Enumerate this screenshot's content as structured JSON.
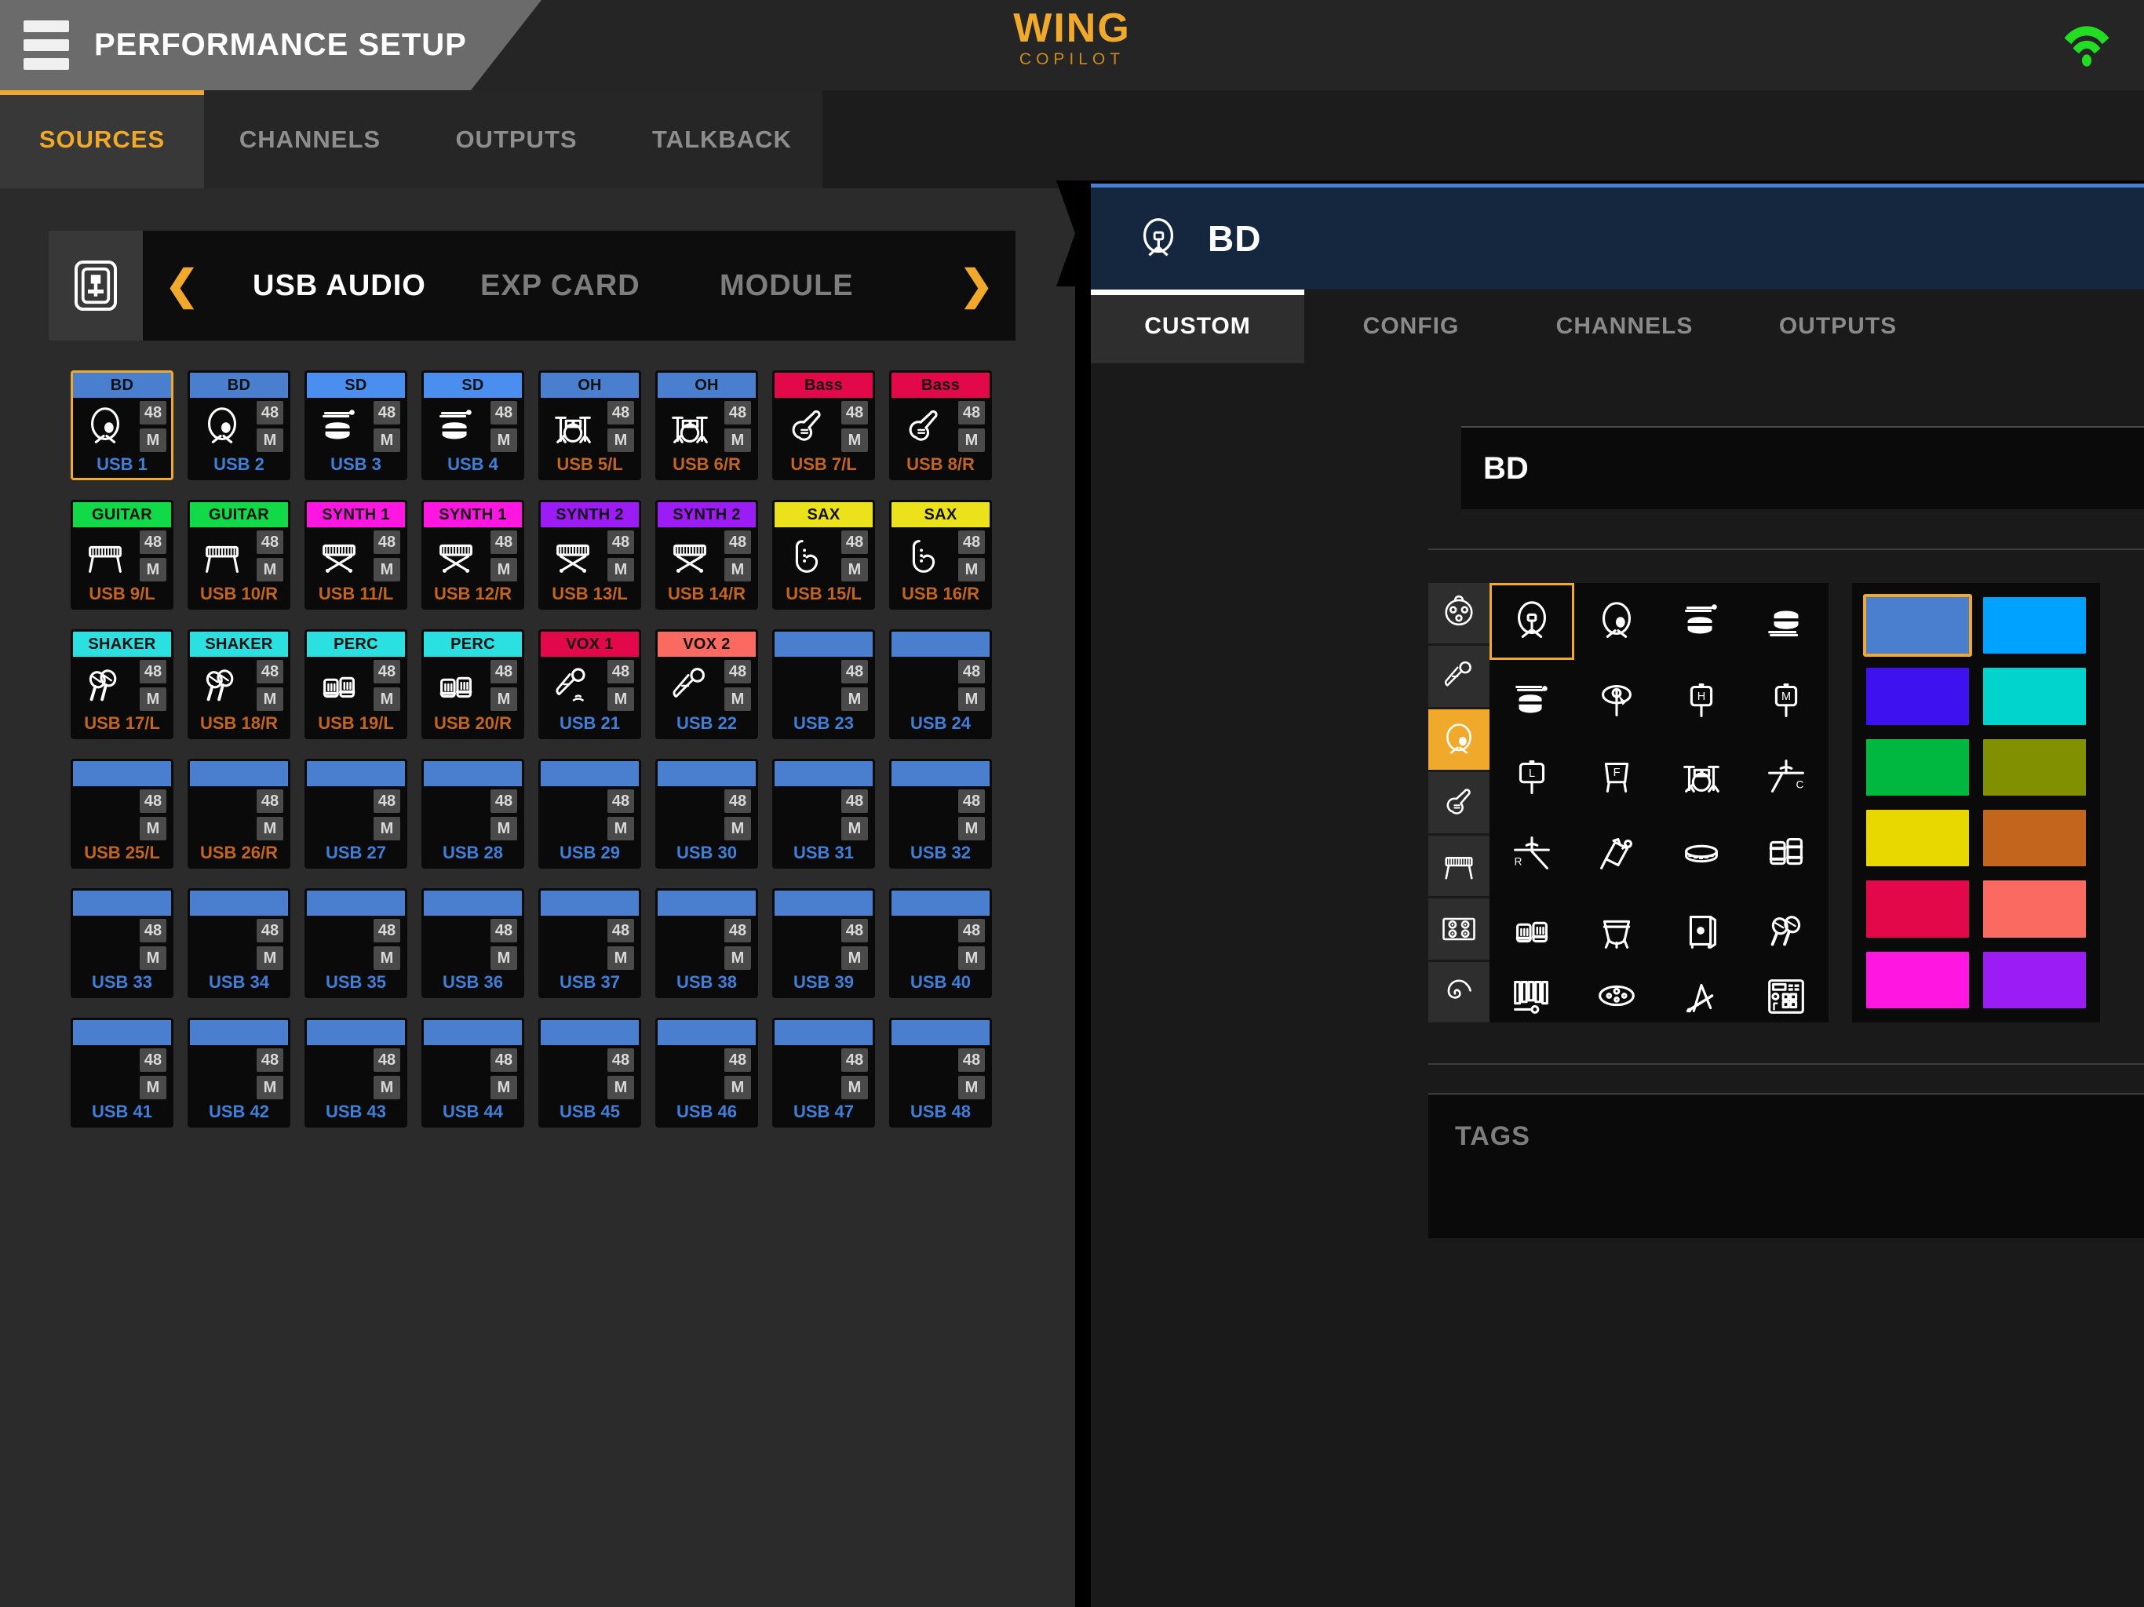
{
  "topbar": {
    "menu_title": "PERFORMANCE SETUP",
    "hamburger_icon": "hamburger-menu-icon",
    "brand_main": "WING",
    "brand_sub": "COPILOT",
    "wifi_icon": "wifi-signal-icon",
    "wifi_color": "#22dd22",
    "accent_color": "#f0a92b"
  },
  "main_tabs": [
    {
      "label": "SOURCES",
      "active": true
    },
    {
      "label": "CHANNELS",
      "active": false
    },
    {
      "label": "OUTPUTS",
      "active": false
    },
    {
      "label": "TALKBACK",
      "active": false
    }
  ],
  "bank_bar": {
    "device_icon": "usb-device-icon",
    "prev_icon": "chevron-left-icon",
    "next_icon": "chevron-right-icon",
    "options": [
      {
        "label": "USB AUDIO",
        "active": true
      },
      {
        "label": "EXP CARD",
        "active": false
      },
      {
        "label": "MODULE",
        "active": false
      }
    ]
  },
  "source_tiles": {
    "badge_gain": "48",
    "badge_mode": "M",
    "rows": [
      [
        {
          "name": "BD",
          "color": "#4a7fd0",
          "icon": "bass-drum-icon",
          "label": "USB 1",
          "label_color": "blue",
          "selected": true
        },
        {
          "name": "BD",
          "color": "#4a7fd0",
          "icon": "bass-drum-icon",
          "label": "USB 2",
          "label_color": "blue",
          "selected": false
        },
        {
          "name": "SD",
          "color": "#4a8ef0",
          "icon": "snare-drum-icon",
          "label": "USB 3",
          "label_color": "blue",
          "selected": false
        },
        {
          "name": "SD",
          "color": "#4a8ef0",
          "icon": "snare-drum-icon",
          "label": "USB 4",
          "label_color": "blue",
          "selected": false
        },
        {
          "name": "OH",
          "color": "#4a7fd0",
          "icon": "drum-kit-icon",
          "label": "USB 5/L",
          "label_color": "orange",
          "selected": false
        },
        {
          "name": "OH",
          "color": "#4a7fd0",
          "icon": "drum-kit-icon",
          "label": "USB 6/R",
          "label_color": "orange",
          "selected": false
        },
        {
          "name": "Bass",
          "color": "#e3084a",
          "icon": "guitar-icon",
          "label": "USB 7/L",
          "label_color": "orange",
          "selected": false
        },
        {
          "name": "Bass",
          "color": "#e3084a",
          "icon": "guitar-icon",
          "label": "USB 8/R",
          "label_color": "orange",
          "selected": false
        }
      ],
      [
        {
          "name": "GUITAR",
          "color": "#12d948",
          "icon": "keyboard-icon",
          "label": "USB 9/L",
          "label_color": "orange",
          "selected": false
        },
        {
          "name": "GUITAR",
          "color": "#12d948",
          "icon": "keyboard-icon",
          "label": "USB 10/R",
          "label_color": "orange",
          "selected": false
        },
        {
          "name": "SYNTH 1",
          "color": "#ff16e0",
          "icon": "synth-stand-icon",
          "label": "USB 11/L",
          "label_color": "orange",
          "selected": false
        },
        {
          "name": "SYNTH 1",
          "color": "#ff16e0",
          "icon": "synth-stand-icon",
          "label": "USB 12/R",
          "label_color": "orange",
          "selected": false
        },
        {
          "name": "SYNTH 2",
          "color": "#9b1cf5",
          "icon": "synth-stand-icon",
          "label": "USB 13/L",
          "label_color": "orange",
          "selected": false
        },
        {
          "name": "SYNTH 2",
          "color": "#9b1cf5",
          "icon": "synth-stand-icon",
          "label": "USB 14/R",
          "label_color": "orange",
          "selected": false
        },
        {
          "name": "SAX",
          "color": "#ece21b",
          "icon": "saxophone-icon",
          "label": "USB 15/L",
          "label_color": "orange",
          "selected": false
        },
        {
          "name": "SAX",
          "color": "#ece21b",
          "icon": "saxophone-icon",
          "label": "USB 16/R",
          "label_color": "orange",
          "selected": false
        }
      ],
      [
        {
          "name": "SHAKER",
          "color": "#2ae0e0",
          "icon": "shaker-icon",
          "label": "USB 17/L",
          "label_color": "orange",
          "selected": false
        },
        {
          "name": "SHAKER",
          "color": "#2ae0e0",
          "icon": "shaker-icon",
          "label": "USB 18/R",
          "label_color": "orange",
          "selected": false
        },
        {
          "name": "PERC",
          "color": "#2ae0e0",
          "icon": "bongos-icon",
          "label": "USB 19/L",
          "label_color": "orange",
          "selected": false
        },
        {
          "name": "PERC",
          "color": "#2ae0e0",
          "icon": "bongos-icon",
          "label": "USB 20/R",
          "label_color": "orange",
          "selected": false
        },
        {
          "name": "VOX 1",
          "color": "#e3084a",
          "icon": "wireless-mic-icon",
          "label": "USB 21",
          "label_color": "blue",
          "selected": false
        },
        {
          "name": "VOX 2",
          "color": "#fb6a60",
          "icon": "microphone-icon",
          "label": "USB 22",
          "label_color": "blue",
          "selected": false
        },
        {
          "name": "",
          "color": "#4a7fd0",
          "icon": "",
          "label": "USB 23",
          "label_color": "blue",
          "selected": false
        },
        {
          "name": "",
          "color": "#4a7fd0",
          "icon": "",
          "label": "USB 24",
          "label_color": "blue",
          "selected": false
        }
      ],
      [
        {
          "name": "",
          "color": "#4a7fd0",
          "icon": "",
          "label": "USB 25/L",
          "label_color": "orange",
          "selected": false
        },
        {
          "name": "",
          "color": "#4a7fd0",
          "icon": "",
          "label": "USB 26/R",
          "label_color": "orange",
          "selected": false
        },
        {
          "name": "",
          "color": "#4a7fd0",
          "icon": "",
          "label": "USB 27",
          "label_color": "blue",
          "selected": false
        },
        {
          "name": "",
          "color": "#4a7fd0",
          "icon": "",
          "label": "USB 28",
          "label_color": "blue",
          "selected": false
        },
        {
          "name": "",
          "color": "#4a7fd0",
          "icon": "",
          "label": "USB 29",
          "label_color": "blue",
          "selected": false
        },
        {
          "name": "",
          "color": "#4a7fd0",
          "icon": "",
          "label": "USB 30",
          "label_color": "blue",
          "selected": false
        },
        {
          "name": "",
          "color": "#4a7fd0",
          "icon": "",
          "label": "USB 31",
          "label_color": "blue",
          "selected": false
        },
        {
          "name": "",
          "color": "#4a7fd0",
          "icon": "",
          "label": "USB 32",
          "label_color": "blue",
          "selected": false
        }
      ],
      [
        {
          "name": "",
          "color": "#4a7fd0",
          "icon": "",
          "label": "USB 33",
          "label_color": "blue",
          "selected": false
        },
        {
          "name": "",
          "color": "#4a7fd0",
          "icon": "",
          "label": "USB 34",
          "label_color": "blue",
          "selected": false
        },
        {
          "name": "",
          "color": "#4a7fd0",
          "icon": "",
          "label": "USB 35",
          "label_color": "blue",
          "selected": false
        },
        {
          "name": "",
          "color": "#4a7fd0",
          "icon": "",
          "label": "USB 36",
          "label_color": "blue",
          "selected": false
        },
        {
          "name": "",
          "color": "#4a7fd0",
          "icon": "",
          "label": "USB 37",
          "label_color": "blue",
          "selected": false
        },
        {
          "name": "",
          "color": "#4a7fd0",
          "icon": "",
          "label": "USB 38",
          "label_color": "blue",
          "selected": false
        },
        {
          "name": "",
          "color": "#4a7fd0",
          "icon": "",
          "label": "USB 39",
          "label_color": "blue",
          "selected": false
        },
        {
          "name": "",
          "color": "#4a7fd0",
          "icon": "",
          "label": "USB 40",
          "label_color": "blue",
          "selected": false
        }
      ],
      [
        {
          "name": "",
          "color": "#4a7fd0",
          "icon": "",
          "label": "USB 41",
          "label_color": "blue",
          "selected": false
        },
        {
          "name": "",
          "color": "#4a7fd0",
          "icon": "",
          "label": "USB 42",
          "label_color": "blue",
          "selected": false
        },
        {
          "name": "",
          "color": "#4a7fd0",
          "icon": "",
          "label": "USB 43",
          "label_color": "blue",
          "selected": false
        },
        {
          "name": "",
          "color": "#4a7fd0",
          "icon": "",
          "label": "USB 44",
          "label_color": "blue",
          "selected": false
        },
        {
          "name": "",
          "color": "#4a7fd0",
          "icon": "",
          "label": "USB 45",
          "label_color": "blue",
          "selected": false
        },
        {
          "name": "",
          "color": "#4a7fd0",
          "icon": "",
          "label": "USB 46",
          "label_color": "blue",
          "selected": false
        },
        {
          "name": "",
          "color": "#4a7fd0",
          "icon": "",
          "label": "USB 47",
          "label_color": "blue",
          "selected": false
        },
        {
          "name": "",
          "color": "#4a7fd0",
          "icon": "",
          "label": "USB 48",
          "label_color": "blue",
          "selected": false
        }
      ]
    ]
  },
  "right_panel": {
    "header_icon": "bass-drum-icon",
    "header_title": "BD",
    "header_bg": "#15263f",
    "header_accent": "#4a7fd0",
    "tabs": [
      {
        "label": "CUSTOM",
        "active": true
      },
      {
        "label": "CONFIG",
        "active": false
      },
      {
        "label": "CHANNELS",
        "active": false
      },
      {
        "label": "OUTPUTS",
        "active": false
      }
    ],
    "name_field": {
      "value": "BD"
    },
    "categories": [
      {
        "icon": "connector-panel-icon",
        "active": false
      },
      {
        "icon": "microphone-icon",
        "active": false
      },
      {
        "icon": "drum-icon",
        "active": true
      },
      {
        "icon": "guitar-icon",
        "active": false
      },
      {
        "icon": "keyboard-icon",
        "active": false
      },
      {
        "icon": "amp-rack-icon",
        "active": false
      },
      {
        "icon": "ear-monitor-icon",
        "active": false
      }
    ],
    "icon_grid": [
      {
        "icon": "bass-drum-pedal-icon",
        "selected": true
      },
      {
        "icon": "bass-drum-icon",
        "selected": false
      },
      {
        "icon": "snare-drum-icon",
        "selected": false
      },
      {
        "icon": "snare-stack-icon",
        "selected": false
      },
      {
        "icon": "snare-sticks-icon",
        "selected": false
      },
      {
        "icon": "hihat-brush-icon",
        "selected": false
      },
      {
        "icon": "tom-h-icon",
        "selected": false
      },
      {
        "icon": "tom-m-icon",
        "selected": false
      },
      {
        "icon": "tom-l-icon",
        "selected": false
      },
      {
        "icon": "floor-tom-f-icon",
        "selected": false
      },
      {
        "icon": "drum-kit-icon",
        "selected": false
      },
      {
        "icon": "cymbal-c-icon",
        "selected": false
      },
      {
        "icon": "cymbal-r-icon",
        "selected": false
      },
      {
        "icon": "cowbell-icon",
        "selected": false
      },
      {
        "icon": "tambourine-icon",
        "selected": false
      },
      {
        "icon": "congas-icon",
        "selected": false
      },
      {
        "icon": "bongos-icon",
        "selected": false
      },
      {
        "icon": "timbale-icon",
        "selected": false
      },
      {
        "icon": "cajon-icon",
        "selected": false
      },
      {
        "icon": "maracas-icon",
        "selected": false
      },
      {
        "icon": "marimba-icon",
        "selected": false
      },
      {
        "icon": "handpan-icon",
        "selected": false
      },
      {
        "icon": "triangle-icon",
        "selected": false
      },
      {
        "icon": "drum-machine-icon",
        "selected": false
      }
    ],
    "palette": [
      {
        "color": "#4a7fd0",
        "selected": true
      },
      {
        "color": "#00a2ff",
        "selected": false
      },
      {
        "color": "#3d11f0",
        "selected": false
      },
      {
        "color": "#00d4cc",
        "selected": false
      },
      {
        "color": "#00b73f",
        "selected": false
      },
      {
        "color": "#809000",
        "selected": false
      },
      {
        "color": "#e8d800",
        "selected": false
      },
      {
        "color": "#c4651d",
        "selected": false
      },
      {
        "color": "#e3084a",
        "selected": false
      },
      {
        "color": "#fb6a60",
        "selected": false
      },
      {
        "color": "#ff16e0",
        "selected": false
      },
      {
        "color": "#9b1cf5",
        "selected": false
      }
    ],
    "tags": {
      "label": "TAGS",
      "value": ""
    }
  }
}
